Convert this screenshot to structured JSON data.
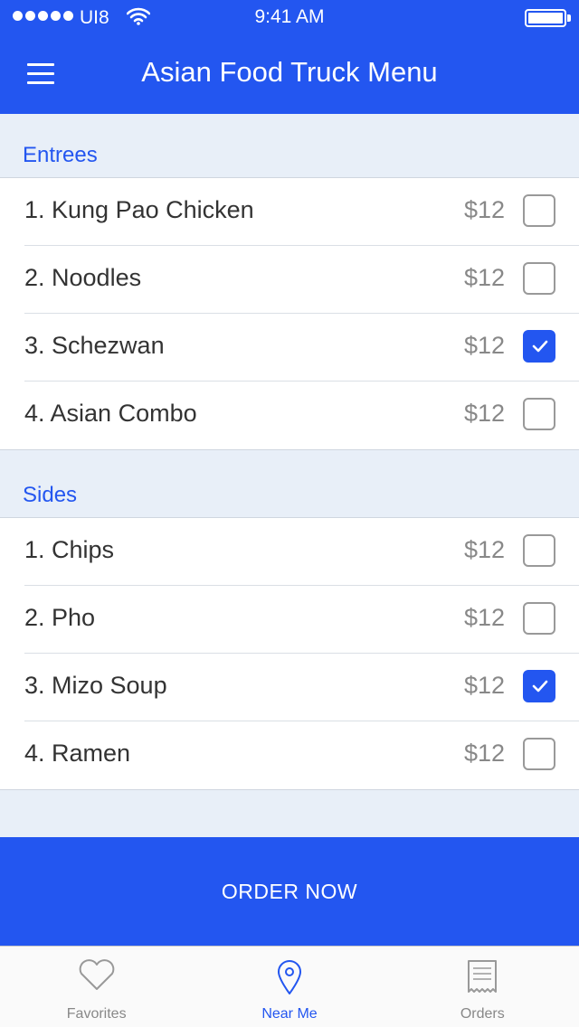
{
  "status_bar": {
    "carrier": "UI8",
    "time": "9:41 AM"
  },
  "header": {
    "title": "Asian Food Truck Menu"
  },
  "sections": [
    {
      "label": "Entrees",
      "items": [
        {
          "name": "1. Kung Pao Chicken",
          "price": "$12",
          "checked": false
        },
        {
          "name": "2. Noodles",
          "price": "$12",
          "checked": false
        },
        {
          "name": "3. Schezwan",
          "price": "$12",
          "checked": true
        },
        {
          "name": "4. Asian Combo",
          "price": "$12",
          "checked": false
        }
      ]
    },
    {
      "label": "Sides",
      "items": [
        {
          "name": "1. Chips",
          "price": "$12",
          "checked": false
        },
        {
          "name": "2. Pho",
          "price": "$12",
          "checked": false
        },
        {
          "name": "3. Mizo Soup",
          "price": "$12",
          "checked": true
        },
        {
          "name": "4. Ramen",
          "price": "$12",
          "checked": false
        }
      ]
    }
  ],
  "order_button": {
    "label": "ORDER NOW"
  },
  "tabbar": {
    "tabs": [
      {
        "label": "Favorites",
        "icon": "heart-icon",
        "active": false
      },
      {
        "label": "Near Me",
        "icon": "location-pin-icon",
        "active": true
      },
      {
        "label": "Orders",
        "icon": "receipt-icon",
        "active": false
      }
    ]
  },
  "colors": {
    "accent": "#2356f0",
    "background": "#e8eff8",
    "text": "#333333",
    "price": "#888888"
  }
}
